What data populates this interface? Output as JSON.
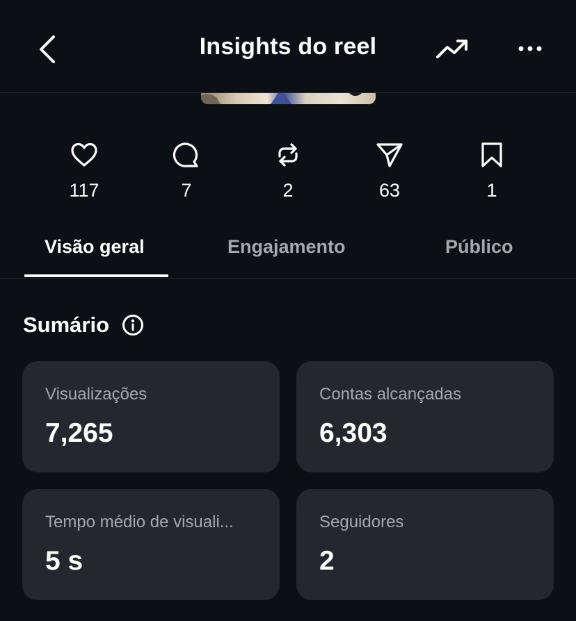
{
  "header": {
    "title": "Insights do reel"
  },
  "stats": [
    {
      "icon": "heart-icon",
      "value": "117"
    },
    {
      "icon": "comment-icon",
      "value": "7"
    },
    {
      "icon": "repost-icon",
      "value": "2"
    },
    {
      "icon": "send-icon",
      "value": "63"
    },
    {
      "icon": "bookmark-icon",
      "value": "1"
    }
  ],
  "tabs": [
    {
      "label": "Visão geral",
      "active": true
    },
    {
      "label": "Engajamento",
      "active": false
    },
    {
      "label": "Público",
      "active": false
    }
  ],
  "summary": {
    "title": "Sumário",
    "cards": [
      {
        "label": "Visualizações",
        "value": "7,265"
      },
      {
        "label": "Contas alcançadas",
        "value": "6,303"
      },
      {
        "label": "Tempo médio de visuali...",
        "value": "5 s"
      },
      {
        "label": "Seguidores",
        "value": "2"
      }
    ]
  },
  "colors": {
    "background": "#0c0f14",
    "card": "#24272e",
    "muted_text": "#a4a8b0",
    "text": "#ffffff"
  }
}
